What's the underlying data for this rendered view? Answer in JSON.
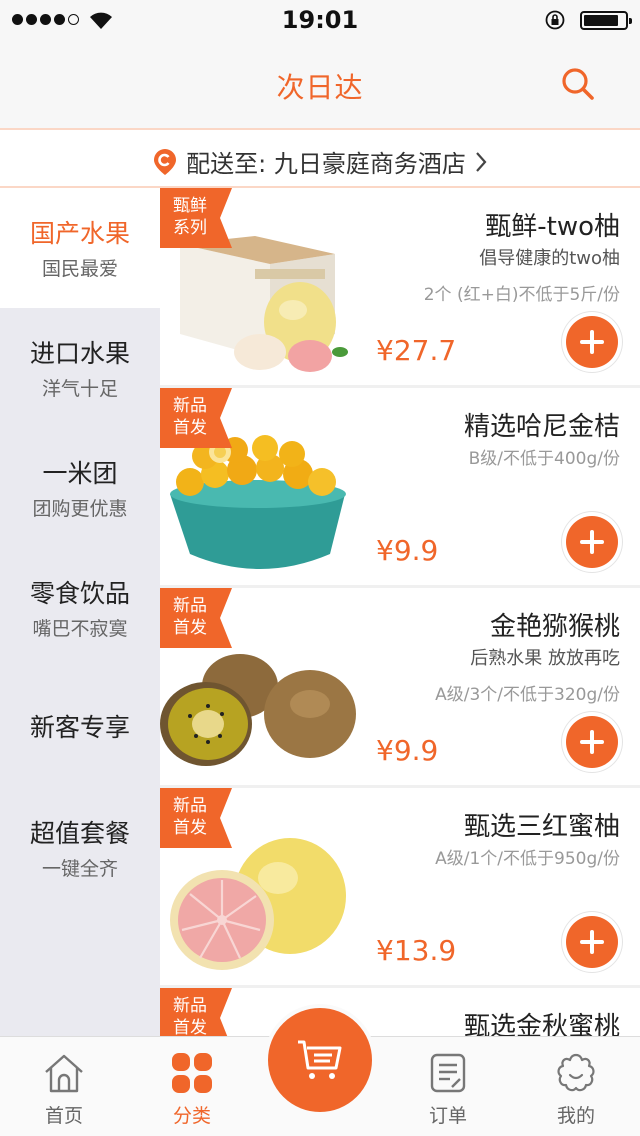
{
  "status_bar": {
    "time": "19:01"
  },
  "header": {
    "title": "次日达",
    "search_icon": "search-icon"
  },
  "delivery": {
    "label": "配送至: 九日豪庭商务酒店",
    "icon": "location-pin-icon"
  },
  "categories": [
    {
      "title": "国产水果",
      "subtitle": "国民最爱",
      "active": true
    },
    {
      "title": "进口水果",
      "subtitle": "洋气十足"
    },
    {
      "title": "一米团",
      "subtitle": "团购更优惠"
    },
    {
      "title": "零食饮品",
      "subtitle": "嘴巴不寂寞"
    },
    {
      "title": "新客专享",
      "subtitle": ""
    },
    {
      "title": "超值套餐",
      "subtitle": "一键全齐"
    }
  ],
  "products": [
    {
      "tag": [
        "甄鲜",
        "系列"
      ],
      "name": "甄鲜-two柚",
      "desc": "倡导健康的two柚",
      "spec": "2个 (红+白)不低于5斤/份",
      "price": "¥27.7"
    },
    {
      "tag": [
        "新品",
        "首发"
      ],
      "name": "精选哈尼金桔",
      "desc": "",
      "spec": "B级/不低于400g/份",
      "price": "¥9.9"
    },
    {
      "tag": [
        "新品",
        "首发"
      ],
      "name": "金艳猕猴桃",
      "desc": "后熟水果 放放再吃",
      "spec": "A级/3个/不低于320g/份",
      "price": "¥9.9"
    },
    {
      "tag": [
        "新品",
        "首发"
      ],
      "name": "甄选三红蜜柚",
      "desc": "",
      "spec": "A级/1个/不低于950g/份",
      "price": "¥13.9"
    },
    {
      "tag": [
        "新品",
        "首发"
      ],
      "name": "甄选金秋蜜桃",
      "desc": "",
      "spec": "",
      "price": ""
    }
  ],
  "tabbar": {
    "home": "首页",
    "category": "分类",
    "orders": "订单",
    "me": "我的"
  },
  "colors": {
    "accent": "#f0662a",
    "sidebar_bg": "#eaeaf0"
  }
}
